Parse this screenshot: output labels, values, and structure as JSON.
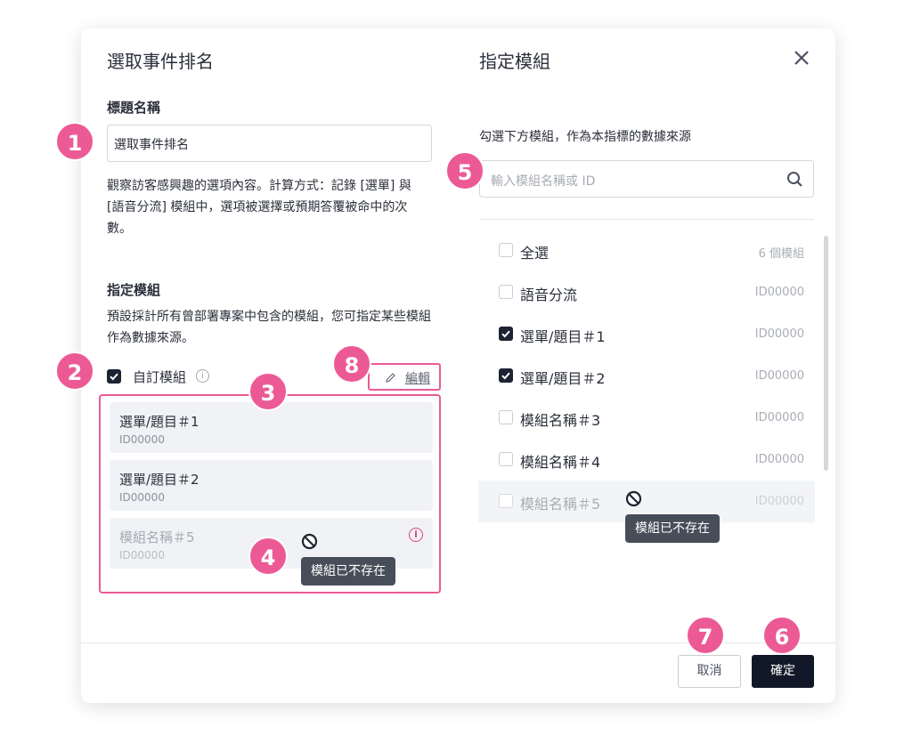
{
  "left": {
    "title": "選取事件排名",
    "title_label": "標題名稱",
    "title_value": "選取事件排名",
    "description": "觀察訪客感興趣的選項內容。計算方式：記錄 [選單] 與 [語音分流] 模組中，選項被選擇或預期答覆被命中的次數。",
    "module_label": "指定模組",
    "module_description": "預設採計所有曾部署專案中包含的模組，您可指定某些模組作為數據來源。",
    "custom_module_label": "自訂模組",
    "edit_label": "編輯",
    "modules": [
      {
        "name": "選單/題目＃1",
        "id": "ID00000"
      },
      {
        "name": "選單/題目＃2",
        "id": "ID00000"
      },
      {
        "name": "模組名稱＃5",
        "id": "ID00000"
      }
    ],
    "tooltip": "模組已不存在"
  },
  "right": {
    "title": "指定模組",
    "description": "勾選下方模組，作為本指標的數據來源",
    "search_placeholder": "輸入模組名稱或 ID",
    "rows": [
      {
        "name": "全選",
        "meta": "6 個模組",
        "checked": false
      },
      {
        "name": "語音分流",
        "meta": "ID00000",
        "checked": false
      },
      {
        "name": "選單/題目＃1",
        "meta": "ID00000",
        "checked": true
      },
      {
        "name": "選單/題目＃2",
        "meta": "ID00000",
        "checked": true
      },
      {
        "name": "模組名稱＃3",
        "meta": "ID00000",
        "checked": false
      },
      {
        "name": "模組名稱＃4",
        "meta": "ID00000",
        "checked": false
      },
      {
        "name": "模組名稱＃5",
        "meta": "ID00000",
        "checked": false
      }
    ],
    "tooltip": "模組已不存在"
  },
  "footer": {
    "cancel_label": "取消",
    "confirm_label": "確定"
  },
  "badges": [
    "1",
    "2",
    "3",
    "4",
    "5",
    "6",
    "7",
    "8"
  ],
  "colors": {
    "badge": "#ec5a96",
    "primary": "#1c2333",
    "highlight_border": "#ec5a96",
    "info_icon_red": "#e0457b"
  }
}
